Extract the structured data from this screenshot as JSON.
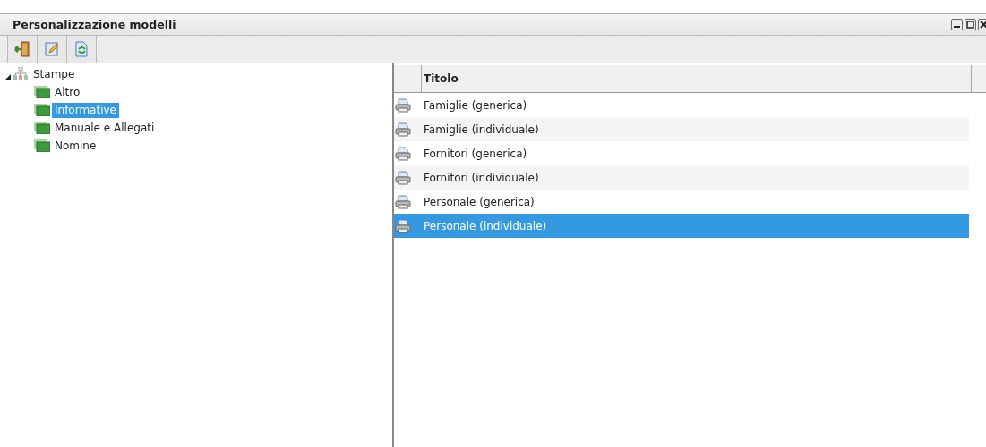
{
  "window": {
    "title": "Personalizzazione modelli"
  },
  "tree": {
    "label": "Stampe",
    "expanded": true,
    "selected": false,
    "children": [
      {
        "label": "Altro",
        "selected": false
      },
      {
        "label": "Informative",
        "selected": true
      },
      {
        "label": "Manuale e Allegati",
        "selected": false
      },
      {
        "label": "Nomine",
        "selected": false
      }
    ]
  },
  "table": {
    "columns": [
      {
        "label": "Titolo"
      }
    ],
    "rows": [
      {
        "title": "Famiglie (generica)",
        "selected": false
      },
      {
        "title": "Famiglie (individuale)",
        "selected": false
      },
      {
        "title": "Fornitori (generica)",
        "selected": false
      },
      {
        "title": "Fornitori (individuale)",
        "selected": false
      },
      {
        "title": "Personale (generica)",
        "selected": false
      },
      {
        "title": "Personale (individuale)",
        "selected": true
      }
    ]
  }
}
